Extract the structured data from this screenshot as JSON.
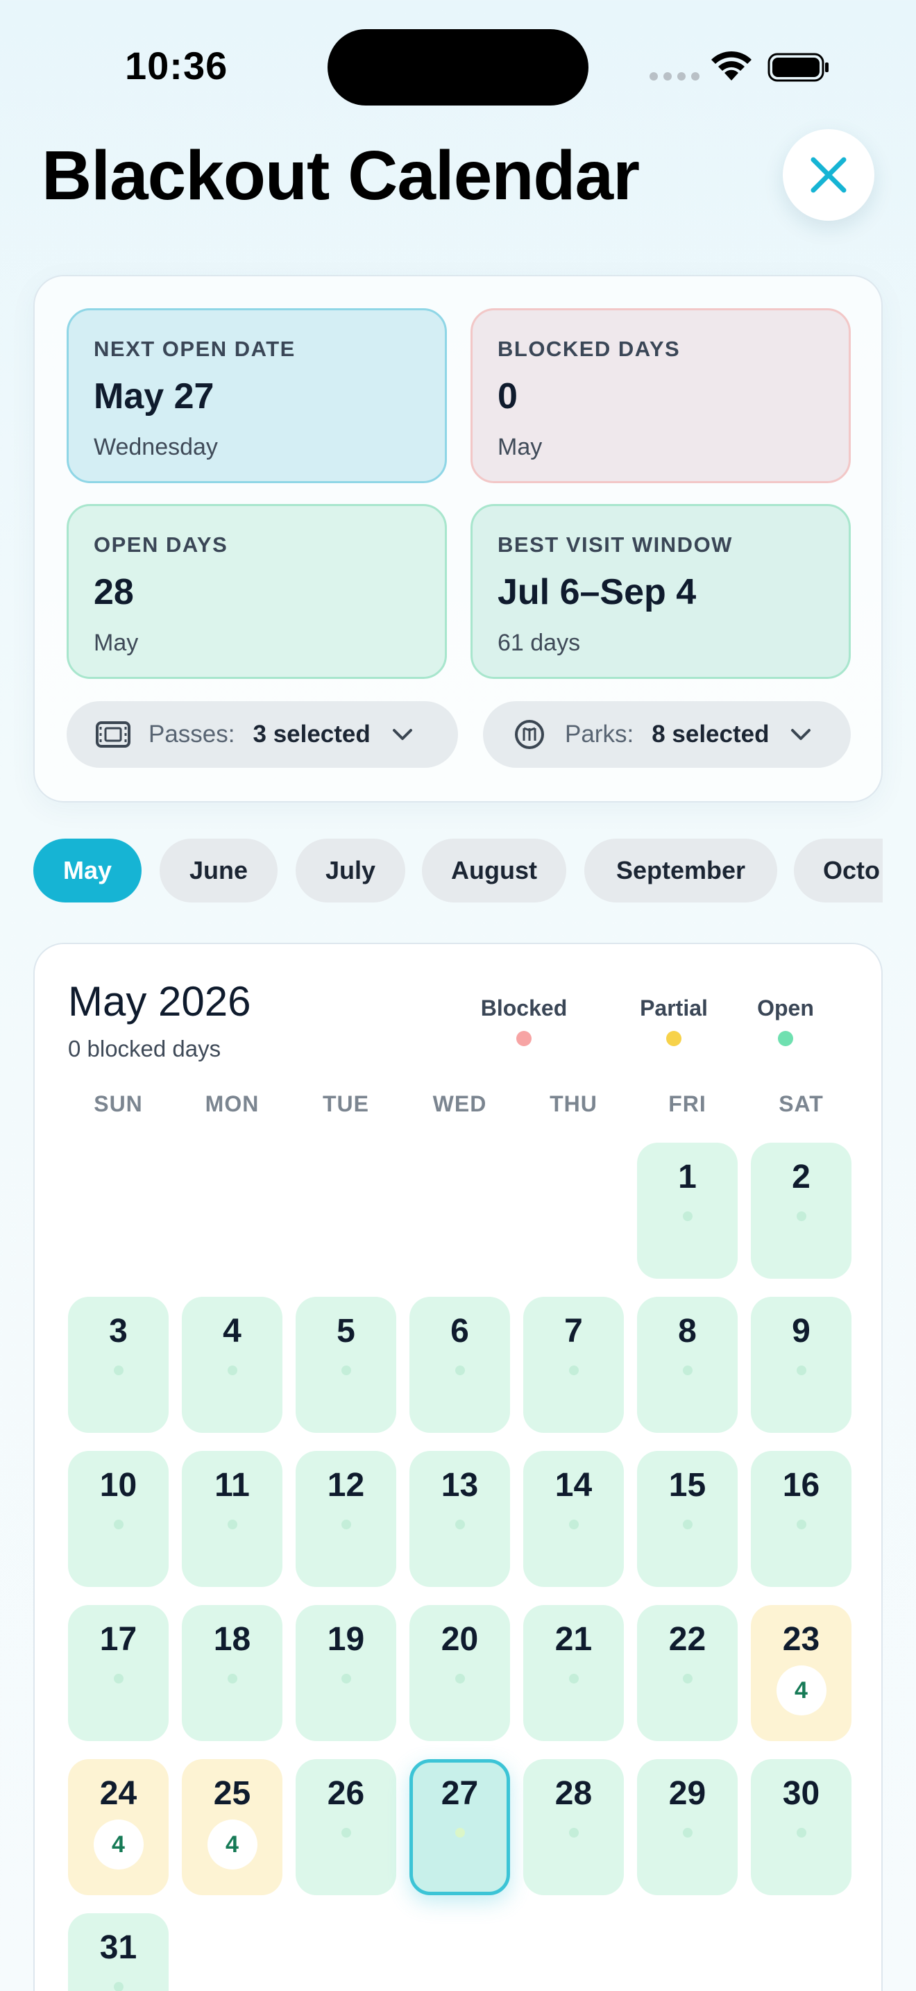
{
  "status_bar": {
    "time": "10:36"
  },
  "header": {
    "title": "Blackout Calendar"
  },
  "summary": {
    "next_open": {
      "label": "NEXT OPEN DATE",
      "value": "May 27",
      "sub": "Wednesday"
    },
    "blocked": {
      "label": "BLOCKED DAYS",
      "value": "0",
      "sub": "May"
    },
    "open": {
      "label": "OPEN DAYS",
      "value": "28",
      "sub": "May"
    },
    "window": {
      "label": "BEST VISIT WINDOW",
      "value": "Jul 6–Sep 4",
      "sub": "61 days"
    }
  },
  "filters": {
    "passes": {
      "label": "Passes:",
      "value": "3 selected",
      "icon": "ticket-icon"
    },
    "parks": {
      "label": "Parks:",
      "value": "8 selected",
      "icon": "park-icon"
    }
  },
  "month_tabs": [
    "May",
    "June",
    "July",
    "August",
    "September",
    "Octo"
  ],
  "active_month": "May",
  "calendar": {
    "title": "May 2026",
    "subtitle": "0 blocked days",
    "legend": [
      {
        "label": "Blocked",
        "color": "#f7a4a4"
      },
      {
        "label": "Partial",
        "color": "#f7d24a"
      },
      {
        "label": "Open",
        "color": "#6fe0b0"
      }
    ],
    "weekdays": [
      "SUN",
      "MON",
      "TUE",
      "WED",
      "THU",
      "FRI",
      "SAT"
    ],
    "first_weekday_index": 5,
    "days": [
      {
        "d": "1",
        "s": "open"
      },
      {
        "d": "2",
        "s": "open"
      },
      {
        "d": "3",
        "s": "open"
      },
      {
        "d": "4",
        "s": "open"
      },
      {
        "d": "5",
        "s": "open"
      },
      {
        "d": "6",
        "s": "open"
      },
      {
        "d": "7",
        "s": "open"
      },
      {
        "d": "8",
        "s": "open"
      },
      {
        "d": "9",
        "s": "open"
      },
      {
        "d": "10",
        "s": "open"
      },
      {
        "d": "11",
        "s": "open"
      },
      {
        "d": "12",
        "s": "open"
      },
      {
        "d": "13",
        "s": "open"
      },
      {
        "d": "14",
        "s": "open"
      },
      {
        "d": "15",
        "s": "open"
      },
      {
        "d": "16",
        "s": "open"
      },
      {
        "d": "17",
        "s": "open"
      },
      {
        "d": "18",
        "s": "open"
      },
      {
        "d": "19",
        "s": "open"
      },
      {
        "d": "20",
        "s": "open"
      },
      {
        "d": "21",
        "s": "open"
      },
      {
        "d": "22",
        "s": "open"
      },
      {
        "d": "23",
        "s": "partial",
        "count": "4"
      },
      {
        "d": "24",
        "s": "partial",
        "count": "4"
      },
      {
        "d": "25",
        "s": "partial",
        "count": "4"
      },
      {
        "d": "26",
        "s": "open"
      },
      {
        "d": "27",
        "s": "open",
        "selected": true
      },
      {
        "d": "28",
        "s": "open"
      },
      {
        "d": "29",
        "s": "open"
      },
      {
        "d": "30",
        "s": "open"
      },
      {
        "d": "31",
        "s": "open"
      }
    ]
  }
}
